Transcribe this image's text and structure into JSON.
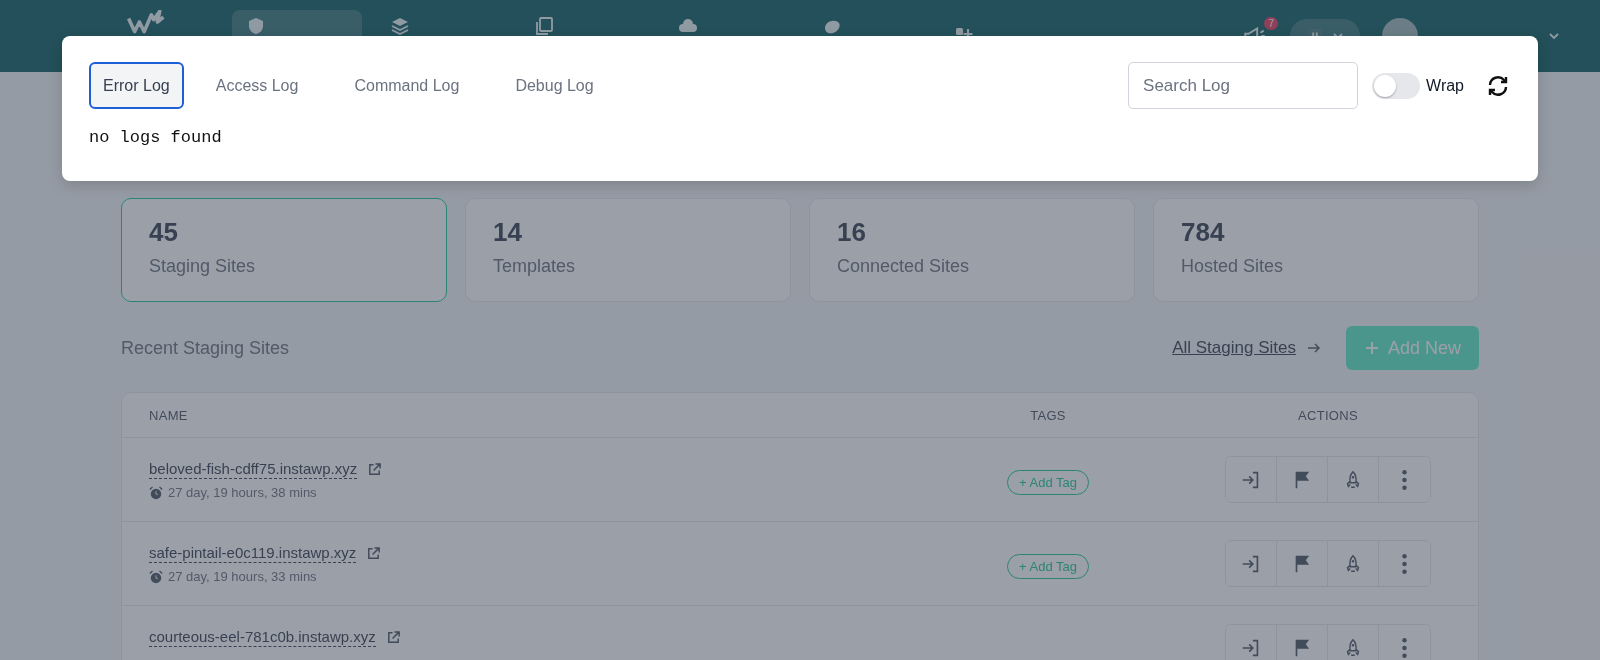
{
  "nav": {
    "items": [
      {
        "selected": true
      },
      {
        "selected": false
      },
      {
        "selected": false
      },
      {
        "selected": false
      },
      {
        "selected": false
      }
    ],
    "notification_count": "7"
  },
  "log_modal": {
    "tabs": [
      {
        "label": "Error Log",
        "selected": true
      },
      {
        "label": "Access Log",
        "selected": false
      },
      {
        "label": "Command Log",
        "selected": false
      },
      {
        "label": "Debug Log",
        "selected": false
      }
    ],
    "search": {
      "placeholder": "Search Log"
    },
    "wrap": {
      "label": "Wrap",
      "on": false
    },
    "message": "no logs found"
  },
  "stats": [
    {
      "value": "45",
      "label": "Staging Sites",
      "selected": true
    },
    {
      "value": "14",
      "label": "Templates",
      "selected": false
    },
    {
      "value": "16",
      "label": "Connected Sites",
      "selected": false
    },
    {
      "value": "784",
      "label": "Hosted Sites",
      "selected": false
    }
  ],
  "section": {
    "title": "Recent Staging Sites",
    "link": "All Staging Sites",
    "button": "Add New"
  },
  "table": {
    "columns": [
      "NAME",
      "TAGS",
      "ACTIONS"
    ],
    "rows": [
      {
        "name": "beloved-fish-cdff75.instawp.xyz",
        "age": "27 day, 19 hours, 38 mins",
        "tag_button": "+ Add Tag"
      },
      {
        "name": "safe-pintail-e0c119.instawp.xyz",
        "age": "27 day, 19 hours, 33 mins",
        "tag_button": "+ Add Tag"
      },
      {
        "name": "courteous-eel-781c0b.instawp.xyz"
      }
    ]
  }
}
